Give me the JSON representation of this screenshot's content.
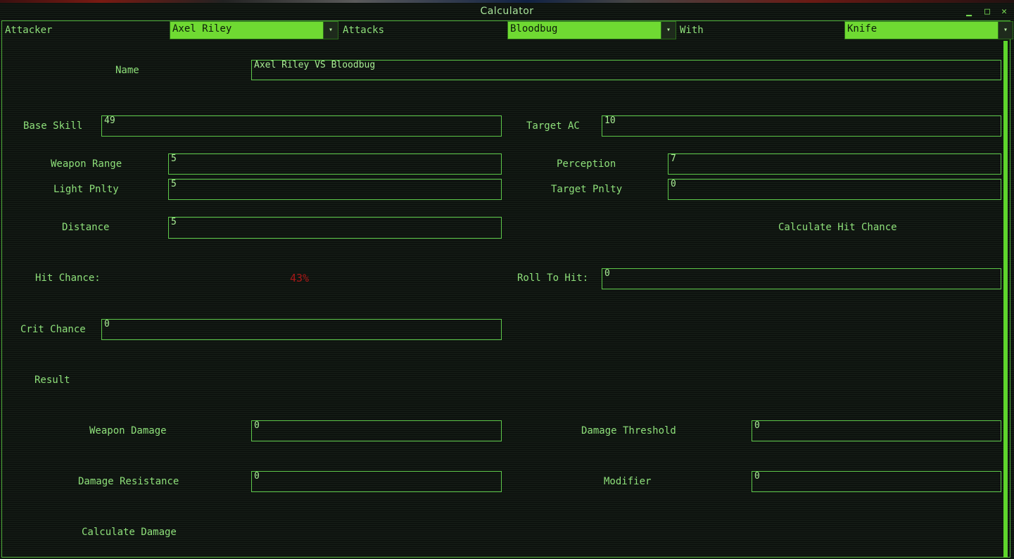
{
  "window": {
    "title": "Calculator",
    "controls": {
      "minimize": "▁",
      "maximize": "□",
      "close": "✕"
    }
  },
  "header": {
    "attacker_label": "Attacker",
    "attacker_value": "Axel Riley",
    "attacks_label": "Attacks",
    "target_value": "Bloodbug",
    "with_label": "With",
    "weapon_value": "Knife",
    "dropdown_glyph": "▾"
  },
  "form": {
    "name_label": "Name",
    "name_value": "Axel Riley VS Bloodbug",
    "base_skill_label": "Base Skill",
    "base_skill_value": "49",
    "target_ac_label": "Target AC",
    "target_ac_value": "10",
    "weapon_range_label": "Weapon Range",
    "weapon_range_value": "5",
    "perception_label": "Perception",
    "perception_value": "7",
    "light_pnlty_label": "Light Pnlty",
    "light_pnlty_value": "5",
    "target_pnlty_label": "Target Pnlty",
    "target_pnlty_value": "0",
    "distance_label": "Distance",
    "distance_value": "5",
    "calc_hit_label": "Calculate Hit Chance",
    "hit_chance_label": "Hit Chance:",
    "hit_chance_value": "43%",
    "roll_to_hit_label": "Roll To Hit:",
    "roll_to_hit_value": "0",
    "crit_chance_label": "Crit Chance",
    "crit_chance_value": "0",
    "result_label": "Result",
    "weapon_damage_label": "Weapon Damage",
    "weapon_damage_value": "0",
    "damage_threshold_label": "Damage Threshold",
    "damage_threshold_value": "0",
    "damage_resistance_label": "Damage Resistance",
    "damage_resistance_value": "0",
    "modifier_label": "Modifier",
    "modifier_value": "0",
    "calc_damage_label": "Calculate Damage"
  },
  "colors": {
    "text": "#8ee07a",
    "accent": "#6fda32",
    "hit_chance": "#a81818",
    "background": "#131a14"
  }
}
